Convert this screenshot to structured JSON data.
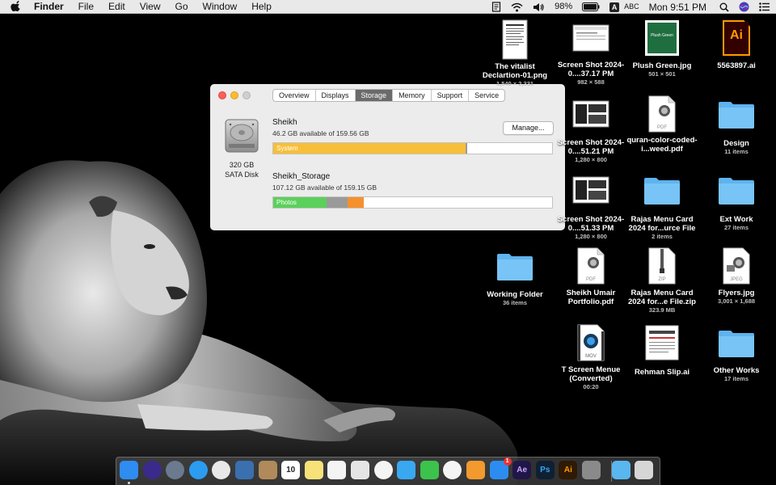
{
  "menubar": {
    "app_name": "Finder",
    "items": [
      "File",
      "Edit",
      "View",
      "Go",
      "Window",
      "Help"
    ],
    "battery": "98%",
    "input_source": "ABC",
    "input_badge": "A",
    "clock": "Mon 9:51 PM"
  },
  "about_window": {
    "tabs": [
      "Overview",
      "Displays",
      "Storage",
      "Memory",
      "Support",
      "Service"
    ],
    "active_tab": "Storage",
    "disk": {
      "size": "320 GB",
      "type": "SATA Disk"
    },
    "volumes": [
      {
        "name": "Sheikh",
        "available": "46.2 GB available of 159.56 GB",
        "bar_label": "System",
        "segments": [
          {
            "kind": "System",
            "fraction": 0.69,
            "color": "#f7bf39"
          },
          {
            "kind": "Other",
            "fraction": 0.005,
            "color": "#9a9a9a"
          }
        ]
      },
      {
        "name": "Sheikh_Storage",
        "available": "107.12 GB available of 159.15 GB",
        "bar_label": "Photos",
        "segments": [
          {
            "kind": "Photos",
            "fraction": 0.19,
            "color": "#5bd05b"
          },
          {
            "kind": "Other",
            "fraction": 0.075,
            "color": "#9a9a9a"
          },
          {
            "kind": "Apps",
            "fraction": 0.06,
            "color": "#f5902c"
          }
        ]
      }
    ],
    "manage_label": "Manage..."
  },
  "desktop": [
    {
      "label": "The vitalist Declartion-01.png",
      "sub": "1,540 × 2,331",
      "icon": "png-document-icon"
    },
    {
      "label": "Screen Shot 2024-0....37.17 PM",
      "sub": "982 × 588",
      "icon": "screenshot-icon"
    },
    {
      "label": "Plush Green.jpg",
      "sub": "501 × 501",
      "icon": "image-icon"
    },
    {
      "label": "5563897.ai",
      "sub": "",
      "icon": "illustrator-file-icon"
    },
    {
      "label": "Screen Shot 2024-0....51.21 PM",
      "sub": "1,280 × 800",
      "icon": "screenshot-icon"
    },
    {
      "label": "quran-color-coded-i...weed.pdf",
      "sub": "",
      "icon": "pdf-icon"
    },
    {
      "label": "Design",
      "sub": "11 items",
      "icon": "folder-icon"
    },
    {
      "label": "Screen Shot 2024-0....51.33 PM",
      "sub": "1,280 × 800",
      "icon": "screenshot-icon"
    },
    {
      "label": "Rajas Menu Card 2024 for...urce File",
      "sub": "2 items",
      "icon": "folder-icon"
    },
    {
      "label": "Ext Work",
      "sub": "27 items",
      "icon": "folder-icon"
    },
    {
      "label": "Working Folder",
      "sub": "36 items",
      "icon": "folder-icon"
    },
    {
      "label": "Sheikh Umair Portfolio.pdf",
      "sub": "",
      "icon": "pdf-icon"
    },
    {
      "label": "Rajas Menu Card 2024 for...e File.zip",
      "sub": "323.9 MB",
      "icon": "zip-icon"
    },
    {
      "label": "Flyers.jpg",
      "sub": "3,001 × 1,688",
      "icon": "jpeg-icon"
    },
    {
      "label": "T Screen Menue (Converted)",
      "sub": "00:20",
      "icon": "mov-icon"
    },
    {
      "label": "Rehman Slip.ai",
      "sub": "",
      "icon": "ai-document-icon"
    },
    {
      "label": "Other Works",
      "sub": "17 items",
      "icon": "folder-icon"
    }
  ],
  "thumb_text": {
    "plush": "Plush Green",
    "ai": "Ai",
    "pdf": "PDF",
    "zip": "ZIP",
    "jpeg": "JPEG",
    "mov": "MOV"
  },
  "dock": [
    {
      "app": "finder",
      "icon": "finder-icon",
      "color": "#2f8cf0"
    },
    {
      "app": "siri",
      "icon": "siri-icon",
      "color": "#3a2a8c"
    },
    {
      "app": "launchpad",
      "icon": "launchpad-icon",
      "color": "#6c7a8f"
    },
    {
      "app": "safari",
      "icon": "safari-icon",
      "color": "#2c9cf0"
    },
    {
      "app": "chrome",
      "icon": "chrome-icon",
      "color": "#e8e8e8"
    },
    {
      "app": "preview",
      "icon": "preview-icon",
      "color": "#3a6fb0"
    },
    {
      "app": "contacts",
      "icon": "contacts-icon",
      "color": "#b08a5a"
    },
    {
      "app": "calendar",
      "icon": "calendar-icon",
      "color": "#ffffff",
      "text": "10"
    },
    {
      "app": "notes",
      "icon": "notes-icon",
      "color": "#f7e27a"
    },
    {
      "app": "reminders",
      "icon": "reminders-icon",
      "color": "#f4f4f4"
    },
    {
      "app": "keynote",
      "icon": "keynote-icon",
      "color": "#e5e5e5"
    },
    {
      "app": "photos",
      "icon": "photos-icon",
      "color": "#f4f4f4"
    },
    {
      "app": "messages",
      "icon": "messages-icon",
      "color": "#39a8f0"
    },
    {
      "app": "facetime",
      "icon": "facetime-icon",
      "color": "#3cc34b"
    },
    {
      "app": "itunes",
      "icon": "music-icon",
      "color": "#f4f4f4"
    },
    {
      "app": "ibooks",
      "icon": "books-icon",
      "color": "#f29a2e"
    },
    {
      "app": "appstore",
      "icon": "app-store-icon",
      "color": "#2d8cf0",
      "badge": "1"
    },
    {
      "app": "aftereffects",
      "icon": "after-effects-icon",
      "color": "#1f1748",
      "text": "Ae"
    },
    {
      "app": "photoshop",
      "icon": "photoshop-icon",
      "color": "#0f2033",
      "text": "Ps"
    },
    {
      "app": "illustrator",
      "icon": "illustrator-icon",
      "color": "#2f1a06",
      "text": "Ai"
    },
    {
      "app": "systemprefs",
      "icon": "system-preferences-icon",
      "color": "#8a8a8a"
    },
    {
      "app": "downloads",
      "icon": "downloads-folder-icon",
      "color": "#5ab6ee"
    },
    {
      "app": "trash",
      "icon": "trash-icon",
      "color": "#d6d6d6"
    }
  ]
}
